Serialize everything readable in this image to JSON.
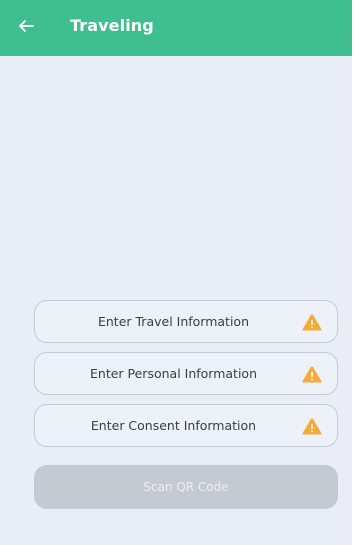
{
  "app_bar": {
    "title": "Traveling",
    "back_icon": "arrow-left-icon",
    "color": "#3fbf8f"
  },
  "actions": [
    {
      "label": "Enter Travel Information",
      "status_icon": "warning-icon"
    },
    {
      "label": "Enter Personal Information",
      "status_icon": "warning-icon"
    },
    {
      "label": "Enter Consent Information",
      "status_icon": "warning-icon"
    }
  ],
  "scan_button": {
    "label": "Scan QR Code",
    "disabled": true
  },
  "colors": {
    "background": "#e9edf5",
    "warning": "#f4ab3a",
    "disabled_button": "#c5c9d0"
  }
}
